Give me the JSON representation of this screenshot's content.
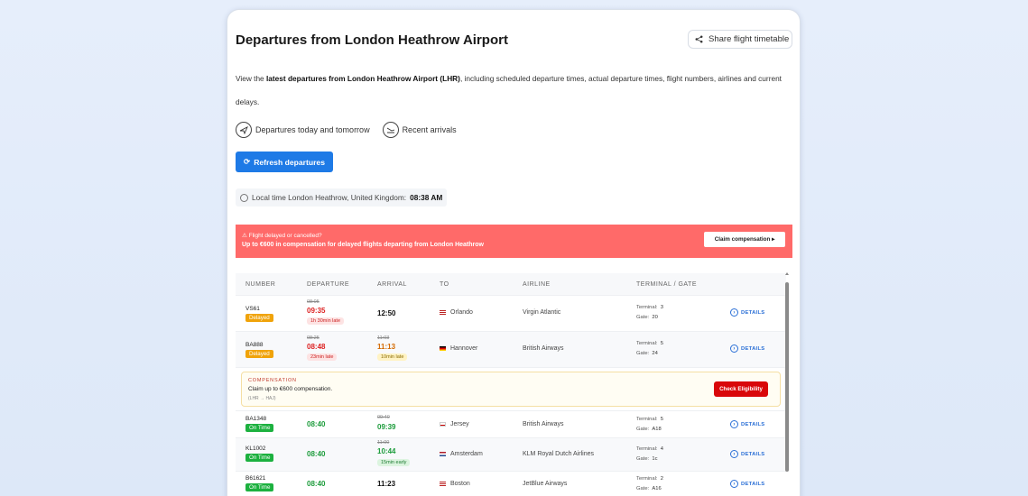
{
  "header": {
    "title": "Departures from London Heathrow Airport",
    "share_label": "Share flight timetable"
  },
  "intro": {
    "p1": "View the ",
    "p1_bold": "latest departures from London Heathrow Airport (LHR)",
    "p2": ", including scheduled departure times, actual departure times, flight numbers, airlines and current delays."
  },
  "quick_links": [
    {
      "label": "Departures today and tomorrow",
      "icon": "plane-takeoff-icon"
    },
    {
      "label": "Recent arrivals",
      "icon": "plane-landing-icon"
    }
  ],
  "refresh_label": "Refresh departures",
  "local_time": {
    "label": "Local time London Heathrow, United Kingdom:",
    "value": "08:38 AM"
  },
  "banner": {
    "line1": "⚠ Flight delayed or cancelled?",
    "line2": "Up to €600 in compensation for delayed flights departing from London Heathrow",
    "button": "Claim compensation ▸",
    "color": "#ff6a69"
  },
  "table": {
    "columns": [
      "NUMBER",
      "DEPARTURE",
      "ARRIVAL",
      "TO",
      "AIRLINE",
      "TERMINAL / GATE"
    ],
    "details_label": "DETAILS",
    "terminal_label": "Terminal:",
    "gate_label": "Gate:",
    "rows": [
      {
        "number": "VS61",
        "status": "Delayed",
        "status_type": "delayed",
        "dep_sched": "08:05",
        "dep_actual": "09:35",
        "dep_note": "1h 30min late",
        "arr_sched": "",
        "arr_actual": "12:50",
        "arr_note": "",
        "dest": "Orlando",
        "flag": "us",
        "airline": "Virgin Atlantic",
        "terminal": "3",
        "gate": "20"
      },
      {
        "number": "BA888",
        "status": "Delayed",
        "status_type": "delayed",
        "dep_sched": "08:25",
        "dep_actual": "08:48",
        "dep_note": "23min late",
        "arr_sched": "11:03",
        "arr_actual": "11:13",
        "arr_note": "10min late",
        "dest": "Hannover",
        "flag": "de",
        "airline": "British Airways",
        "terminal": "5",
        "gate": "24"
      },
      {
        "number": "BA1348",
        "status": "On Time",
        "status_type": "ontime",
        "dep_sched": "",
        "dep_actual": "08:40",
        "dep_note": "",
        "arr_sched": "09:40",
        "arr_actual": "09:39",
        "arr_note": "",
        "dest": "Jersey",
        "flag": "je",
        "airline": "British Airways",
        "terminal": "5",
        "gate": "A18"
      },
      {
        "number": "KL1002",
        "status": "On Time",
        "status_type": "ontime",
        "dep_sched": "",
        "dep_actual": "08:40",
        "dep_note": "",
        "arr_sched": "11:00",
        "arr_actual": "10:44",
        "arr_note": "15min early",
        "dest": "Amsterdam",
        "flag": "nl",
        "airline": "KLM Royal Dutch Airlines",
        "terminal": "4",
        "gate": "1c"
      },
      {
        "number": "B61621",
        "status": "On Time",
        "status_type": "ontime",
        "dep_sched": "",
        "dep_actual": "08:40",
        "dep_note": "",
        "arr_sched": "",
        "arr_actual": "11:23",
        "arr_note": "",
        "dest": "Boston",
        "flag": "us",
        "airline": "JetBlue Airways",
        "terminal": "2",
        "gate": "A16"
      }
    ]
  },
  "compensation": {
    "heading": "COMPENSATION",
    "text": "Claim up to €600 compensation.",
    "route": "(LHR → HAJ)",
    "button": "Check Eligibility"
  }
}
